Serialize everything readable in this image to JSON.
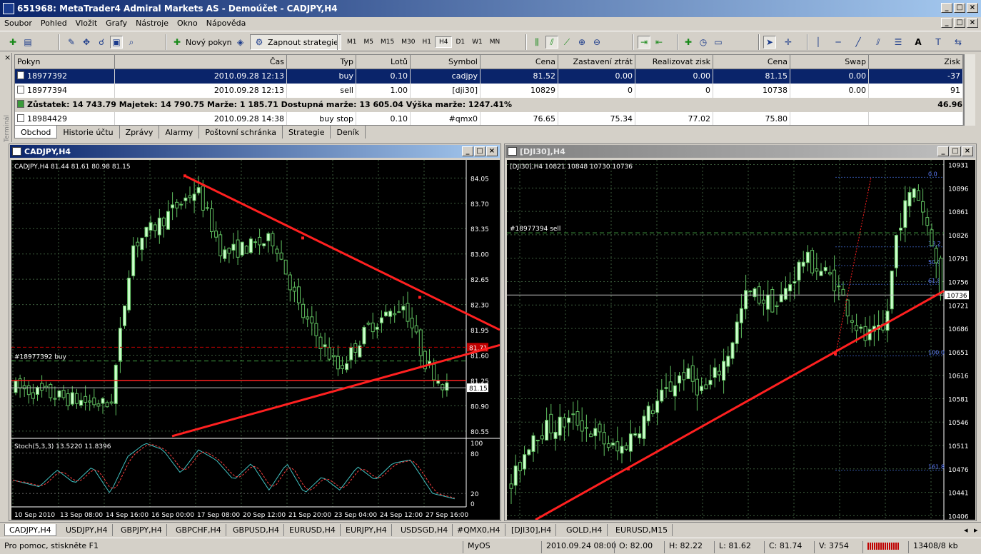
{
  "window": {
    "title": "651968: MetaTrader4 Admiral Markets AS - Demoúčet - CADJPY,H4",
    "min_label": "_",
    "max_label": "□",
    "close_label": "×"
  },
  "menu": [
    "Soubor",
    "Pohled",
    "Vložit",
    "Grafy",
    "Nástroje",
    "Okno",
    "Nápověda"
  ],
  "toolbar": {
    "new_order_label": "Nový pokyn",
    "strategy_label": "Zapnout strategie",
    "timeframes": [
      "M1",
      "M5",
      "M15",
      "M30",
      "H1",
      "H4",
      "D1",
      "W1",
      "MN"
    ],
    "active_timeframe": "H4",
    "text_tool_label": "A"
  },
  "terminal": {
    "side_label": "Terminál",
    "close_label": "×",
    "columns": [
      "Pokyn",
      "Čas",
      "Typ",
      "Lotů",
      "Symbol",
      "Cena",
      "Zastavení ztrát",
      "Realizovat zisk",
      "Cena",
      "Swap",
      "Zisk"
    ],
    "rows": [
      [
        "18977392",
        "2010.09.28 12:13",
        "buy",
        "0.10",
        "cadjpy",
        "81.52",
        "0.00",
        "0.00",
        "81.15",
        "0.00",
        "-37"
      ],
      [
        "18977394",
        "2010.09.28 12:13",
        "sell",
        "1.00",
        "[dji30]",
        "10829",
        "0",
        "0",
        "10738",
        "0.00",
        "91"
      ]
    ],
    "balance_text": "Zůstatek: 14 743.79  Majetek: 14 790.75  Marže: 1 185.71  Dostupná marže: 13 605.04  Výška marže: 1247.41%",
    "balance_profit": "46.96",
    "pending_row": [
      "18984429",
      "2010.09.28 14:38",
      "buy stop",
      "0.10",
      "#qmx0",
      "76.65",
      "75.34",
      "77.02",
      "75.80",
      "",
      ""
    ],
    "tabs": [
      "Obchod",
      "Historie účtu",
      "Zprávy",
      "Alarmy",
      "Poštovní schránka",
      "Strategie",
      "Deník"
    ],
    "active_tab": "Obchod"
  },
  "charts": {
    "left": {
      "title": "CADJPY,H4",
      "info": "CADJPY,H4  81.44 81.61 80.98 81.15",
      "order_label": "#18977392 buy",
      "bid_label": "81.15",
      "ask_label": "81.71",
      "indicator_label": "Stoch(5,3,3) 13.5220 11.8396",
      "price_ticks": [
        "84.05",
        "83.70",
        "83.35",
        "83.00",
        "82.65",
        "82.30",
        "81.95",
        "81.60",
        "81.25",
        "80.90",
        "80.55"
      ],
      "stoch_ticks": [
        "100",
        "80",
        "20",
        "0"
      ],
      "time_ticks": [
        "10 Sep 2010",
        "13 Sep 08:00",
        "14 Sep 16:00",
        "16 Sep 00:00",
        "17 Sep 08:00",
        "20 Sep 12:00",
        "21 Sep 20:00",
        "23 Sep 04:00",
        "24 Sep 12:00",
        "27 Sep 16:00"
      ]
    },
    "right": {
      "title": "[DJI30],H4",
      "info": "[DJI30],H4  10821 10848 10730 10736",
      "order_label": "#18977394 sell",
      "bid_label": "10736",
      "price_ticks": [
        "10931",
        "10896",
        "10861",
        "10826",
        "10791",
        "10756",
        "10721",
        "10686",
        "10651",
        "10616",
        "10581",
        "10546",
        "10511",
        "10476",
        "10441",
        "10406"
      ],
      "fib_labels": [
        "0.0",
        "38.2",
        "50.0",
        "61.8",
        "100.0",
        "161.8"
      ]
    }
  },
  "chart_tabs": [
    "CADJPY,H4",
    "USDJPY,H4",
    "GBPJPY,H4",
    "GBPCHF,H4",
    "GBPUSD,H4",
    "EURUSD,H4",
    "EURJPY,H4",
    "USDSGD,H4",
    "#QMX0,H4",
    "[DJI30],H4",
    "GOLD,H4",
    "EURUSD,M15"
  ],
  "active_chart_tab": "CADJPY,H4",
  "status": {
    "help": "Pro pomoc, stiskněte F1",
    "profile": "MyOS",
    "time": "2010.09.24 08:00",
    "open": "O: 82.00",
    "high": "H: 82.22",
    "low": "L: 81.62",
    "close": "C: 81.74",
    "volume": "V: 3754",
    "traffic": "13408/8 kb"
  },
  "colors": {
    "titlebar_active": "#0a246a",
    "titlebar_inactive": "#808080",
    "selected_row": "#0a246a",
    "bull_candle": "#ccffcc",
    "trendline": "#ff2020",
    "grid": "#3c5c3c"
  }
}
